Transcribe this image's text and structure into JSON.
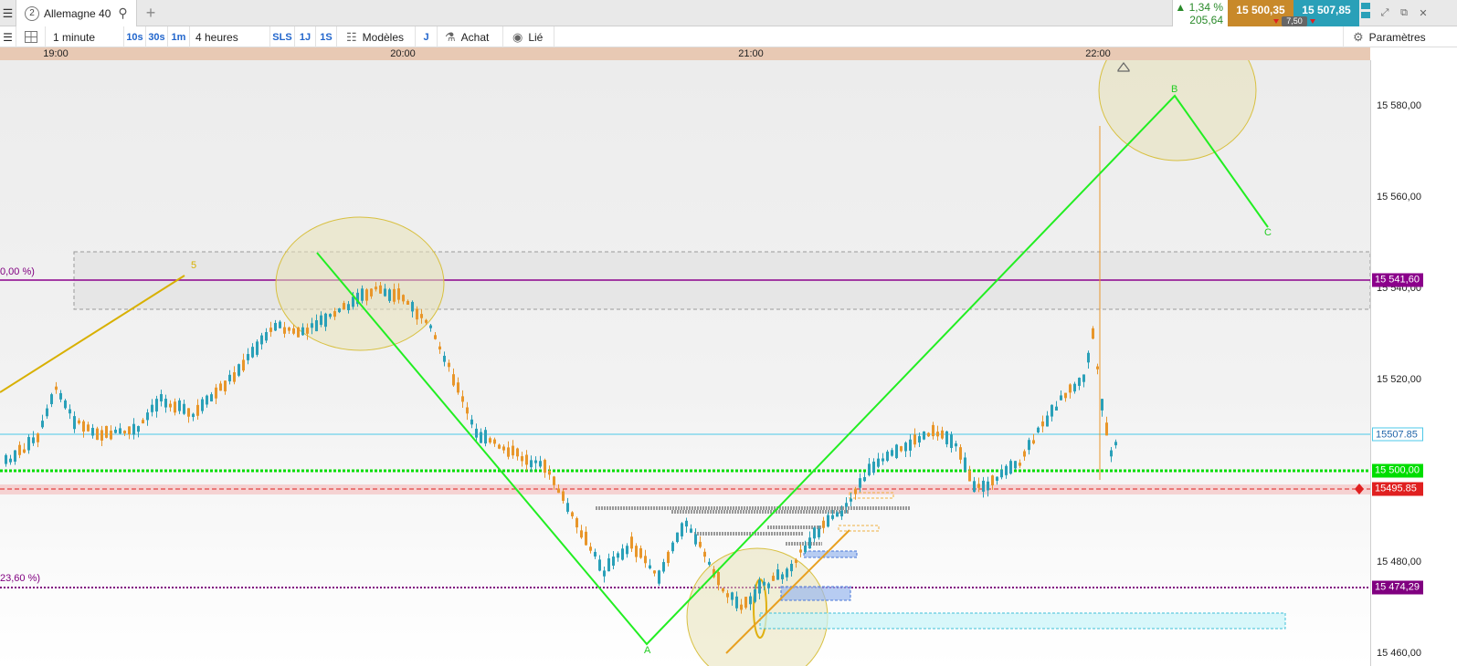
{
  "tabbar": {
    "menu_icon": "hamburger-icon",
    "tab": {
      "number": "2",
      "title": "Allemagne 40"
    },
    "add_icon": "+",
    "change_percent": "▲ 1,34 %",
    "change_points": "205,64",
    "sell_price": "15 500,35",
    "buy_price": "15 507,85",
    "spread": "7,50",
    "window_controls": [
      "⤢",
      "⧉",
      "✕"
    ]
  },
  "toolbar": {
    "timeframe": "1 minute",
    "quick_1": "10s",
    "quick_2": "30s",
    "quick_3": "1m",
    "range": "4 heures",
    "sls": "SLS",
    "j1": "1J",
    "s1": "1S",
    "models": "Modèles",
    "j": "J",
    "buy": "Achat",
    "linked": "Lié",
    "settings": "Paramètres"
  },
  "time_axis": {
    "ticks": [
      "19:00",
      "20:00",
      "21:00",
      "22:00"
    ]
  },
  "price_axis": {
    "ticks": [
      "15 580,00",
      "15 560,00",
      "15 540,00",
      "15 520,00",
      "15 480,00",
      "15 460,00"
    ],
    "tags": {
      "resistance": "15 541,60",
      "offer": "15507.85",
      "bid": "15 500,00",
      "order": "15495.85",
      "fib": "15 474,29"
    }
  },
  "annotations": {
    "fib_100": "0,00 %)",
    "fib_23": "23,60 %)",
    "wave_5": "5",
    "wave_a": "A",
    "wave_b": "B",
    "wave_c": "C"
  },
  "colors": {
    "sell": "#c8892a",
    "buy": "#2aa0b8",
    "up_candle": "#2aa0b8",
    "down_candle": "#e8962a",
    "wave_line": "#22ee22",
    "fib": "#800080",
    "resistance": "#8b008b",
    "bid_line": "#00dd00",
    "order_line": "#e02020",
    "offer_line": "#4dc8e8"
  }
}
